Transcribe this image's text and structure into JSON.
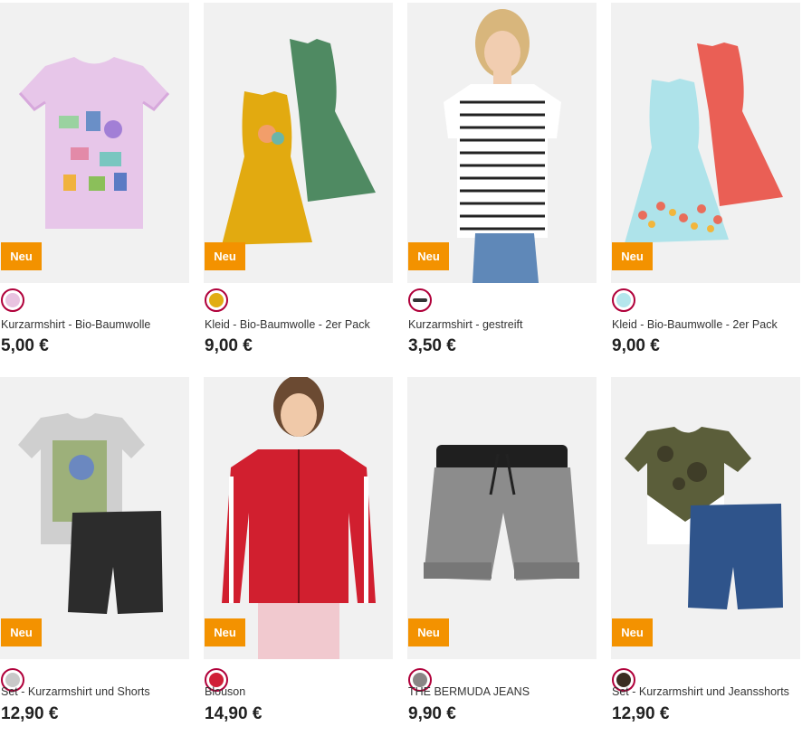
{
  "badge_label": "Neu",
  "products": [
    {
      "name": "Kurzarmshirt - Bio-Baumwolle",
      "price": "5,00 €",
      "swatch": "#e8c3e0",
      "image": "lilac-tshirt"
    },
    {
      "name": "Kleid - Bio-Baumwolle - 2er Pack",
      "price": "9,00 €",
      "swatch": "#e1ad12",
      "image": "yellow-green-dresses"
    },
    {
      "name": "Kurzarmshirt - gestreift",
      "price": "3,50 €",
      "swatch": "stripe",
      "image": "striped-shirt-girl"
    },
    {
      "name": "Kleid - Bio-Baumwolle - 2er Pack",
      "price": "9,00 €",
      "swatch": "#b4e6ec",
      "image": "blue-red-dresses"
    },
    {
      "name": "Set - Kurzarmshirt und Shorts",
      "price": "12,90 €",
      "swatch": "#c8c8c8",
      "image": "grey-tshirt-shorts"
    },
    {
      "name": "Blouson",
      "price": "14,90 €",
      "swatch": "#d01f37",
      "image": "red-bomber-girl"
    },
    {
      "name": "THE BERMUDA JEANS",
      "price": "9,90 €",
      "swatch": "#8a8585",
      "image": "grey-denim-shorts"
    },
    {
      "name": "Set - Kurzarmshirt und Jeansshorts",
      "price": "12,90 €",
      "swatch": "#3a2e22",
      "image": "camo-tshirt-jeansshorts"
    }
  ]
}
